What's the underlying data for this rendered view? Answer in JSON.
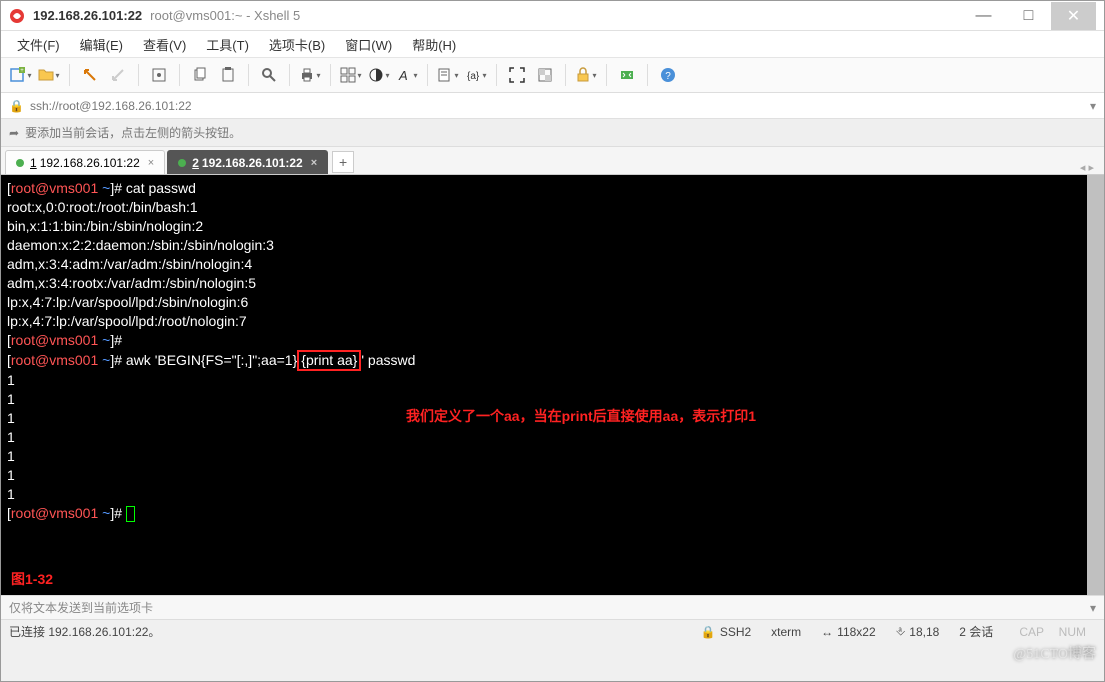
{
  "window": {
    "title_host": "192.168.26.101:22",
    "title_session": "root@vms001:~ - Xshell 5"
  },
  "menu": {
    "file": "文件(F)",
    "edit": "编辑(E)",
    "view": "查看(V)",
    "tools": "工具(T)",
    "tabs": "选项卡(B)",
    "window": "窗口(W)",
    "help": "帮助(H)"
  },
  "address": {
    "url": "ssh://root@192.168.26.101:22"
  },
  "session_hint": "要添加当前会话，点击左侧的箭头按钮。",
  "tabs": [
    {
      "num": "1",
      "label": "192.168.26.101:22",
      "active": false
    },
    {
      "num": "2",
      "label": "192.168.26.101:22",
      "active": true
    }
  ],
  "terminal": {
    "lines": [
      {
        "prompt": true,
        "cmd": "cat passwd"
      },
      {
        "text": "root:x,0:0:root:/root:/bin/bash:1"
      },
      {
        "text": "bin,x:1:1:bin:/bin:/sbin/nologin:2"
      },
      {
        "text": "daemon:x:2:2:daemon:/sbin:/sbin/nologin:3"
      },
      {
        "text": "adm,x:3:4:adm:/var/adm:/sbin/nologin:4"
      },
      {
        "text": "adm,x:3:4:rootx:/var/adm:/sbin/nologin:5"
      },
      {
        "text": "lp:x,4:7:lp:/var/spool/lpd:/sbin/nologin:6"
      },
      {
        "text": "lp:x,4:7:lp:/var/spool/lpd:/root/nologin:7"
      },
      {
        "prompt": true,
        "cmd": ""
      }
    ],
    "awk_pre": "awk 'BEGIN{FS=\"[:,]\";aa=1}",
    "awk_box": "{print aa}",
    "awk_post": "' passwd",
    "ones": [
      "1",
      "1",
      "1",
      "1",
      "1",
      "1",
      "1"
    ],
    "annotation": "我们定义了一个aa，当在print后直接使用aa，表示打印1",
    "figure": "图1-32",
    "prompt_user": "root@vms001",
    "prompt_path": "~"
  },
  "sendbar": "仅将文本发送到当前选项卡",
  "status": {
    "conn": "已连接 192.168.26.101:22。",
    "proto": "SSH2",
    "term": "xterm",
    "size": "118x22",
    "pos": "18,18",
    "sess": "2 会话",
    "cap": "CAP",
    "num": "NUM"
  },
  "watermark": "@51CTO博客",
  "icons": {
    "minimize": "—",
    "maximize": "□",
    "close": "✕",
    "add": "+",
    "lock": "🔒",
    "arrow": "▾",
    "tab_nav": "◂ ▸",
    "size_ic": "↔",
    "sess_arrow": "➦"
  }
}
